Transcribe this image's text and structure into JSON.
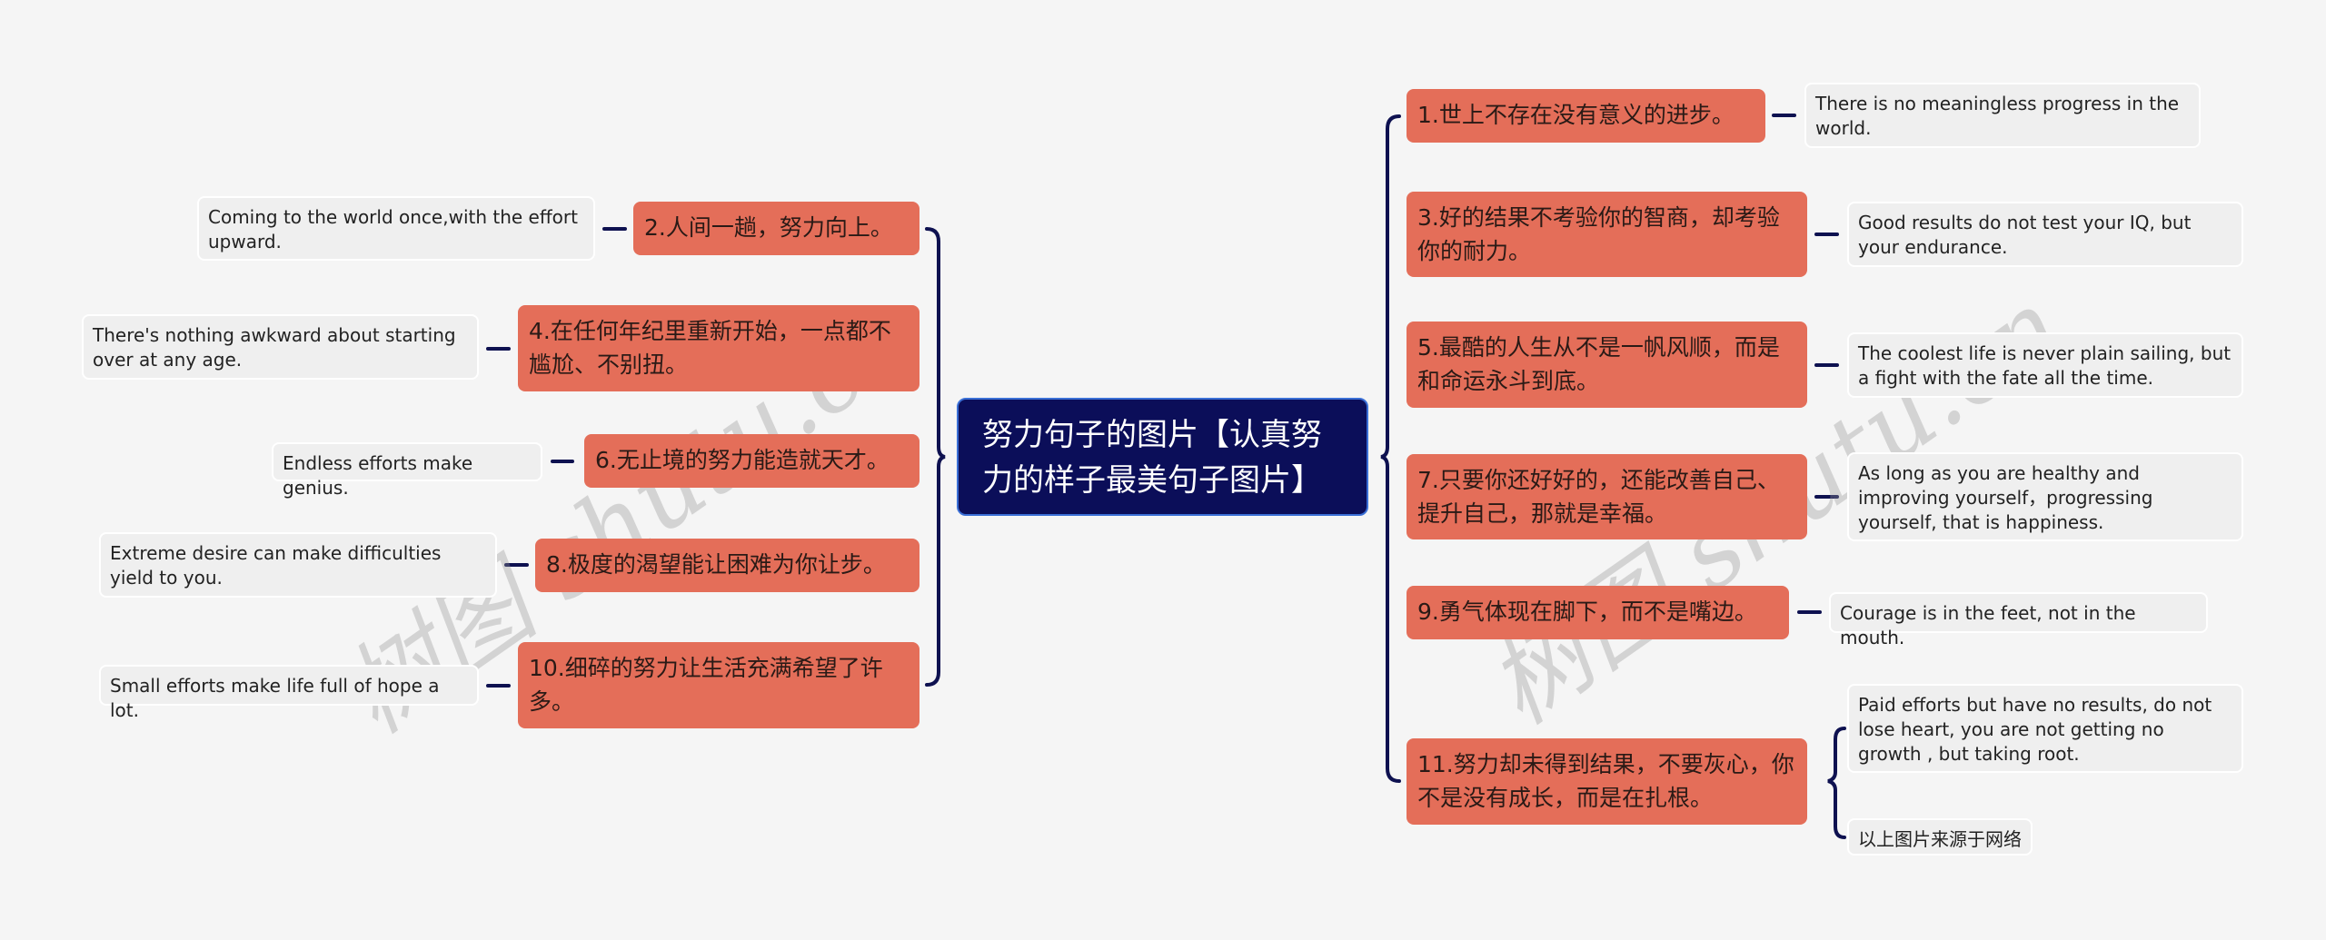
{
  "root": {
    "title": "努力句子的图片【认真努力的样子最美句子图片】"
  },
  "left": [
    {
      "topic": "2.人间一趟，努力向上。",
      "note": "Coming to the world once,with the effort upward."
    },
    {
      "topic": "4.在任何年纪里重新开始，一点都不尴尬、不别扭。",
      "note": "There's nothing awkward about starting over at any age."
    },
    {
      "topic": "6.无止境的努力能造就天才。",
      "note": "Endless efforts make genius."
    },
    {
      "topic": "8.极度的渴望能让困难为你让步。",
      "note": "Extreme desire can make difficulties yield to you."
    },
    {
      "topic": "10.细碎的努力让生活充满希望了许多。",
      "note": "Small efforts make life full of hope a lot."
    }
  ],
  "right": [
    {
      "topic": "1.世上不存在没有意义的进步。",
      "note": "There is no meaningless progress in the world."
    },
    {
      "topic": "3.好的结果不考验你的智商，却考验你的耐力。",
      "note": "Good results do not test your IQ, but your endurance."
    },
    {
      "topic": "5.最酷的人生从不是一帆风顺，而是和命运永斗到底。",
      "note": "The coolest life is never plain sailing, but a fight with the fate all the time."
    },
    {
      "topic": "7.只要你还好好的，还能改善自己、提升自己，那就是幸福。",
      "note": "As long as you are healthy and improving  yourself，progressing yourself, that is happiness."
    },
    {
      "topic": "9.勇气体现在脚下，而不是嘴边。",
      "note": "Courage is in the feet, not in the mouth."
    },
    {
      "topic": "11.努力却未得到结果，不要灰心，你不是没有成长，而是在扎根。",
      "note": "Paid efforts but have no results, do not lose heart, you are not getting no growth , but taking root.",
      "note2": "以上图片来源于网络"
    }
  ],
  "watermark": "树图 shutu.cn",
  "colors": {
    "topic": "#e46e59",
    "root": "#0b0e59",
    "line": "#0e1150",
    "leaf": "#efefef",
    "background": "#f5f5f5"
  }
}
